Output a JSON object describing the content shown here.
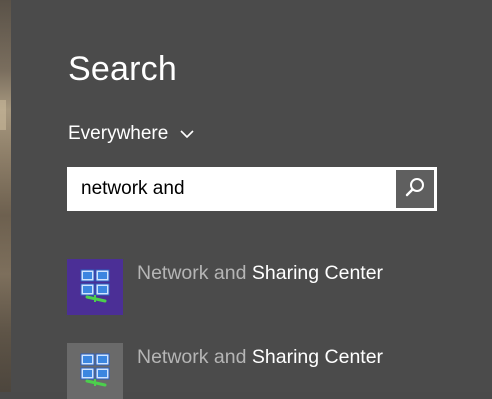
{
  "search_panel": {
    "title": "Search",
    "scope": {
      "label": "Everywhere",
      "icon": "chevron-down-icon"
    },
    "search": {
      "value": "network and",
      "button_icon": "search-icon"
    },
    "results": [
      {
        "match_text": "Network and",
        "rest_text": "Sharing Center",
        "icon": "network-sharing-center-icon",
        "highlighted": true
      },
      {
        "match_text": "Network and",
        "rest_text": "Sharing Center",
        "icon": "network-sharing-center-icon",
        "highlighted": false
      }
    ]
  },
  "colors": {
    "panel_background": "#4b4b4b",
    "highlight_tile": "#4b2f96",
    "tile": "#6a6a6a",
    "search_button": "#5f5f5f",
    "match_text": "#b5b5b5"
  }
}
